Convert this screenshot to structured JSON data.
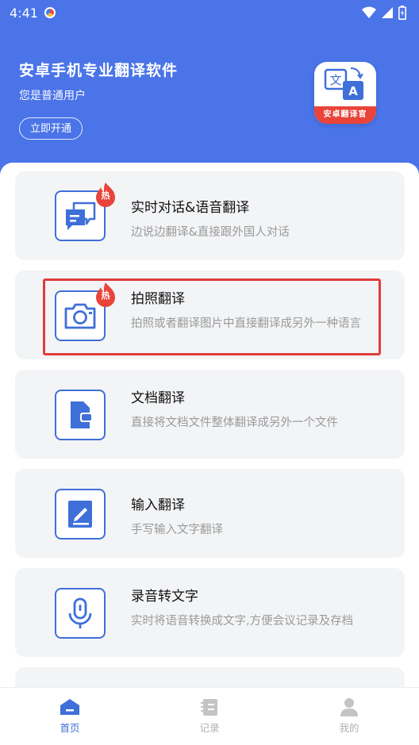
{
  "status_bar": {
    "time": "4:41"
  },
  "header": {
    "app_title": "安卓手机专业翻译软件",
    "user_status": "您是普通用户",
    "open_button": "立即开通",
    "logo_label": "安卓翻译官",
    "logo_glyph_left": "文",
    "logo_glyph_right": "A"
  },
  "features": [
    {
      "title": "实时对话&语音翻译",
      "desc": "边说边翻译&直接跟外国人对话",
      "hot": "热",
      "icon": "chat-bubbles-icon"
    },
    {
      "title": "拍照翻译",
      "desc": "拍照或者翻译图片中直接翻译成另外一种语言",
      "hot": "热",
      "icon": "camera-icon"
    },
    {
      "title": "文档翻译",
      "desc": "直接将文档文件整体翻译成另外一个文件",
      "icon": "document-icon"
    },
    {
      "title": "输入翻译",
      "desc": "手写输入文字翻译",
      "icon": "notepad-pen-icon"
    },
    {
      "title": "录音转文字",
      "desc": "实时将语音转换成文字,方便会议记录及存档",
      "icon": "microphone-icon"
    }
  ],
  "bottom_nav": [
    {
      "label": "首页",
      "icon": "home-icon",
      "active": true
    },
    {
      "label": "记录",
      "icon": "records-icon",
      "active": false
    },
    {
      "label": "我的",
      "icon": "profile-icon",
      "active": false
    }
  ],
  "colors": {
    "brand": "#4a74e8",
    "accent": "#3f6fd8",
    "hot": "#e8443a",
    "highlight": "#e23b3b"
  }
}
